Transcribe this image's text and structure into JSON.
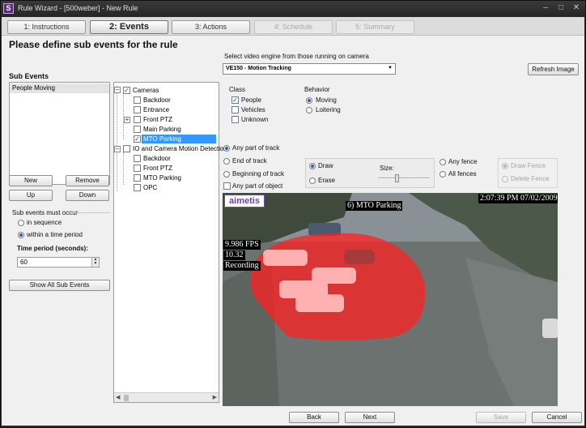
{
  "window": {
    "title": "Rule Wizard - [500weber] - New Rule",
    "icon": "app-icon"
  },
  "steps": [
    {
      "label": "1: Instructions",
      "state": "normal"
    },
    {
      "label": "2: Events",
      "state": "active"
    },
    {
      "label": "3: Actions",
      "state": "normal"
    },
    {
      "label": "4: Schedule",
      "state": "disabled"
    },
    {
      "label": "5: Summary",
      "state": "disabled"
    }
  ],
  "heading": "Please define sub events for the rule",
  "sub_events": {
    "title": "Sub Events",
    "items": [
      "People Moving"
    ],
    "buttons": {
      "new": "New",
      "remove": "Remove",
      "up": "Up",
      "down": "Down"
    },
    "must_occur_label": "Sub events must occur",
    "options": [
      {
        "label": "in sequence",
        "selected": false
      },
      {
        "label": "within a time period",
        "selected": true
      }
    ],
    "time_period_label": "Time period (seconds):",
    "time_period_value": "60",
    "show_all": "Show All Sub Events"
  },
  "tree": {
    "cameras_label": "Cameras",
    "cameras": [
      {
        "label": "Backdoor",
        "checked": false,
        "expandable": false,
        "selected": false
      },
      {
        "label": "Entrance",
        "checked": false,
        "expandable": false,
        "selected": false
      },
      {
        "label": "Front PTZ",
        "checked": false,
        "expandable": true,
        "selected": false
      },
      {
        "label": "Main Parking",
        "checked": false,
        "expandable": false,
        "selected": false
      },
      {
        "label": "MTO Parking",
        "checked": true,
        "expandable": false,
        "selected": true
      }
    ],
    "io_label": "IO and Camera Motion Detection",
    "io": [
      {
        "label": "Backdoor",
        "checked": false
      },
      {
        "label": "Front PTZ",
        "checked": false
      },
      {
        "label": "MTO Parking",
        "checked": false
      },
      {
        "label": "OPC",
        "checked": false
      }
    ]
  },
  "engine": {
    "label": "Select video engine from those running on camera",
    "value": "VE150 - Motion Tracking",
    "refresh": "Refresh Image"
  },
  "class": {
    "title": "Class",
    "items": [
      {
        "label": "People",
        "checked": true
      },
      {
        "label": "Vehicles",
        "checked": false
      },
      {
        "label": "Unknown",
        "checked": false
      }
    ]
  },
  "behavior": {
    "title": "Behavior",
    "items": [
      {
        "label": "Moving",
        "selected": true
      },
      {
        "label": "Loitering",
        "selected": false
      }
    ]
  },
  "track": [
    {
      "label": "Any part of track",
      "selected": true
    },
    {
      "label": "End of track",
      "selected": false
    },
    {
      "label": "Beginning of track",
      "selected": false
    }
  ],
  "any_part_object": {
    "label": "Any part of object",
    "checked": false
  },
  "draw_mode": [
    {
      "label": "Draw",
      "selected": true
    },
    {
      "label": "Erase",
      "selected": false
    }
  ],
  "size_label": "Size:",
  "size_value": 0.35,
  "fence_mode": [
    {
      "label": "Any fence",
      "selected": false
    },
    {
      "label": "All fences",
      "selected": false
    }
  ],
  "fence_draw": [
    {
      "label": "Draw Fence",
      "selected": true
    },
    {
      "label": "Delete Fence",
      "selected": false
    }
  ],
  "video": {
    "logo": "aimetis",
    "camera_label": "6) MTO Parking",
    "timestamp": "2:07:39 PM 07/02/2009",
    "fps": "9.986 FPS",
    "value": "10.32",
    "status": "Recording",
    "mask_color": "#ff2020"
  },
  "footer": {
    "back": "Back",
    "next": "Next",
    "save": "Save",
    "cancel": "Cancel"
  }
}
